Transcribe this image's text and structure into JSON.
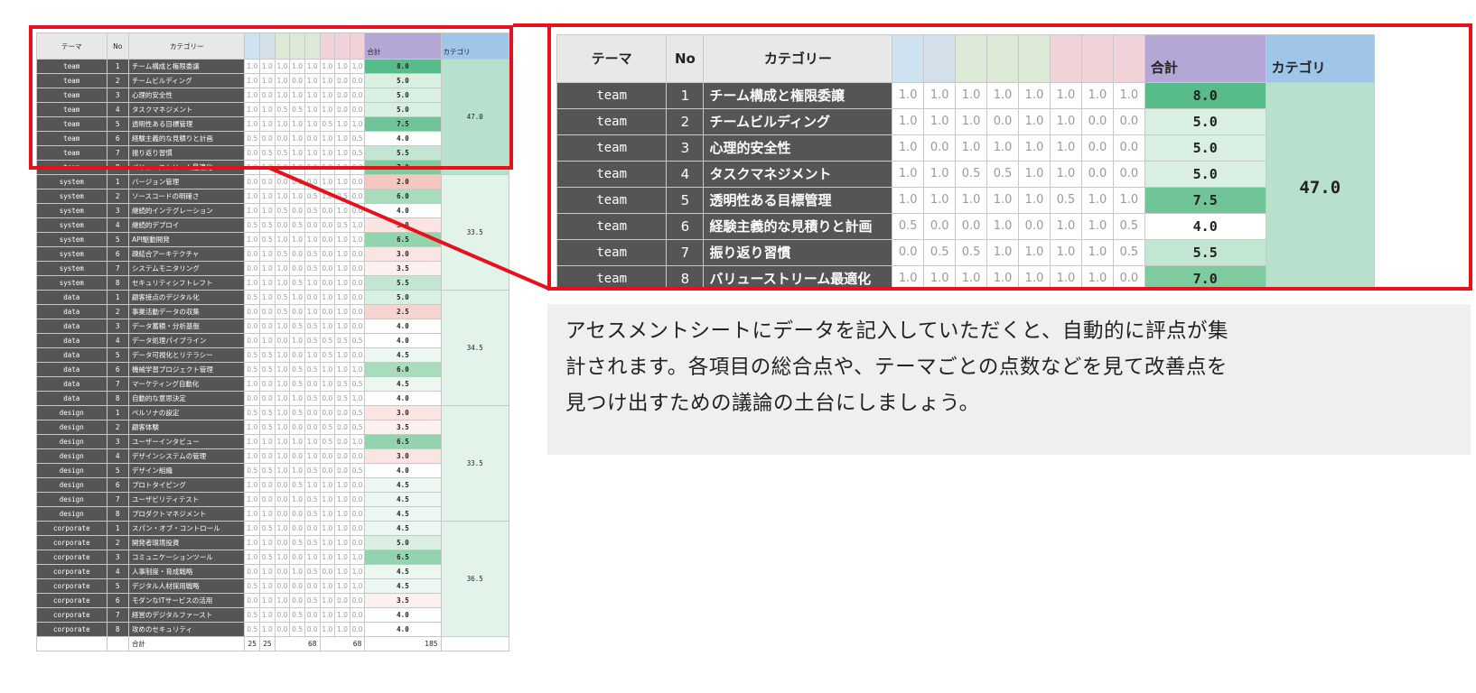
{
  "headers": {
    "theme": "テーマ",
    "no": "No",
    "category": "カテゴリー",
    "sum": "合計",
    "category_total": "カテゴリ"
  },
  "header_colors": [
    "#cfe2f0",
    "#d3e0ea",
    "#dbe9d6",
    "#dbe9d6",
    "#dbe9d6",
    "#f1d2d8",
    "#f1d2d8",
    "#f1d2d8"
  ],
  "colors": {
    "dark_cell": "#555555",
    "sum_header": "#b4a7d6",
    "cat_header": "#9fc5e8",
    "highlight_red": "#e8101a",
    "catsum_fill": "#b7e1cd",
    "catsum_fill_light": "#e2f3ea"
  },
  "groups": [
    {
      "theme": "team",
      "total": "47.0",
      "rows": [
        {
          "no": "1",
          "category": "チーム構成と権限委譲",
          "scores": [
            "1.0",
            "1.0",
            "1.0",
            "1.0",
            "1.0",
            "1.0",
            "1.0",
            "1.0"
          ],
          "sum": "8.0",
          "sum_color": "#57bb8a"
        },
        {
          "no": "2",
          "category": "チームビルディング",
          "scores": [
            "1.0",
            "1.0",
            "1.0",
            "0.0",
            "1.0",
            "1.0",
            "0.0",
            "0.0"
          ],
          "sum": "5.0",
          "sum_color": "#d9efe2"
        },
        {
          "no": "3",
          "category": "心理的安全性",
          "scores": [
            "1.0",
            "0.0",
            "1.0",
            "1.0",
            "1.0",
            "1.0",
            "0.0",
            "0.0"
          ],
          "sum": "5.0",
          "sum_color": "#d9efe2"
        },
        {
          "no": "4",
          "category": "タスクマネジメント",
          "scores": [
            "1.0",
            "1.0",
            "0.5",
            "0.5",
            "1.0",
            "1.0",
            "0.0",
            "0.0"
          ],
          "sum": "5.0",
          "sum_color": "#d9efe2"
        },
        {
          "no": "5",
          "category": "透明性ある目標管理",
          "scores": [
            "1.0",
            "1.0",
            "1.0",
            "1.0",
            "1.0",
            "0.5",
            "1.0",
            "1.0"
          ],
          "sum": "7.5",
          "sum_color": "#6fc597"
        },
        {
          "no": "6",
          "category": "経験主義的な見積りと計画",
          "scores": [
            "0.5",
            "0.0",
            "0.0",
            "1.0",
            "0.0",
            "1.0",
            "1.0",
            "0.5"
          ],
          "sum": "4.0",
          "sum_color": "#ffffff"
        },
        {
          "no": "7",
          "category": "振り返り習慣",
          "scores": [
            "0.0",
            "0.5",
            "0.5",
            "1.0",
            "1.0",
            "1.0",
            "1.0",
            "0.5"
          ],
          "sum": "5.5",
          "sum_color": "#c2e6d1"
        },
        {
          "no": "8",
          "category": "バリューストリーム最適化",
          "scores": [
            "1.0",
            "1.0",
            "1.0",
            "1.0",
            "1.0",
            "1.0",
            "1.0",
            "0.0"
          ],
          "sum": "7.0",
          "sum_color": "#7ecb9f"
        }
      ]
    },
    {
      "theme": "system",
      "total": "33.5",
      "rows": [
        {
          "no": "1",
          "category": "バージョン管理",
          "scores": [
            "0.0",
            "0.0",
            "0.0",
            "0.0",
            "0.0",
            "1.0",
            "1.0",
            "0.0"
          ],
          "sum": "2.0",
          "sum_color": "#f4c7c3"
        },
        {
          "no": "2",
          "category": "ソースコードの明確さ",
          "scores": [
            "1.0",
            "1.0",
            "1.0",
            "1.0",
            "0.5",
            "1.0",
            "0.5",
            "0.0"
          ],
          "sum": "6.0",
          "sum_color": "#a8dcbc"
        },
        {
          "no": "3",
          "category": "継続的インテグレーション",
          "scores": [
            "1.0",
            "1.0",
            "0.5",
            "0.0",
            "0.5",
            "0.0",
            "1.0",
            "0.0"
          ],
          "sum": "4.0",
          "sum_color": "#ffffff"
        },
        {
          "no": "4",
          "category": "継続的デプロイ",
          "scores": [
            "0.5",
            "0.5",
            "0.0",
            "0.5",
            "0.0",
            "0.0",
            "0.5",
            "1.0"
          ],
          "sum": "3.0",
          "sum_color": "#fbe5e3"
        },
        {
          "no": "5",
          "category": "API駆動開発",
          "scores": [
            "1.0",
            "0.5",
            "1.0",
            "1.0",
            "1.0",
            "0.0",
            "1.0",
            "1.0"
          ],
          "sum": "6.5",
          "sum_color": "#93d3ad"
        },
        {
          "no": "6",
          "category": "疎結合アーキテクチャ",
          "scores": [
            "0.0",
            "1.0",
            "0.5",
            "0.0",
            "0.5",
            "0.0",
            "1.0",
            "0.0"
          ],
          "sum": "3.0",
          "sum_color": "#fbe5e3"
        },
        {
          "no": "7",
          "category": "システムモニタリング",
          "scores": [
            "0.0",
            "1.0",
            "1.0",
            "0.0",
            "0.5",
            "0.0",
            "1.0",
            "0.0"
          ],
          "sum": "3.5",
          "sum_color": "#fdf1f0"
        },
        {
          "no": "8",
          "category": "セキュリティシフトレフト",
          "scores": [
            "1.0",
            "1.0",
            "1.0",
            "0.5",
            "1.0",
            "0.0",
            "1.0",
            "0.0"
          ],
          "sum": "5.5",
          "sum_color": "#c2e6d1"
        }
      ]
    },
    {
      "theme": "data",
      "total": "34.5",
      "rows": [
        {
          "no": "1",
          "category": "顧客接点のデジタル化",
          "scores": [
            "0.5",
            "1.0",
            "0.5",
            "1.0",
            "0.0",
            "1.0",
            "1.0",
            "0.0"
          ],
          "sum": "5.0",
          "sum_color": "#d9efe2"
        },
        {
          "no": "2",
          "category": "事業活動データの収集",
          "scores": [
            "0.0",
            "0.0",
            "0.5",
            "0.0",
            "1.0",
            "0.0",
            "1.0",
            "0.0"
          ],
          "sum": "2.5",
          "sum_color": "#f6d4d0"
        },
        {
          "no": "3",
          "category": "データ蓄積・分析基盤",
          "scores": [
            "0.0",
            "0.0",
            "1.0",
            "0.5",
            "0.5",
            "1.0",
            "1.0",
            "0.0"
          ],
          "sum": "4.0",
          "sum_color": "#ffffff"
        },
        {
          "no": "4",
          "category": "データ処理パイプライン",
          "scores": [
            "0.0",
            "1.0",
            "0.0",
            "1.0",
            "0.5",
            "0.5",
            "0.5",
            "0.5"
          ],
          "sum": "4.0",
          "sum_color": "#ffffff"
        },
        {
          "no": "5",
          "category": "データ可視化とリテラシー",
          "scores": [
            "0.5",
            "0.5",
            "1.0",
            "0.0",
            "1.0",
            "0.5",
            "1.0",
            "0.0"
          ],
          "sum": "4.5",
          "sum_color": "#ecf7f1"
        },
        {
          "no": "6",
          "category": "機械学習プロジェクト管理",
          "scores": [
            "0.5",
            "0.5",
            "1.0",
            "0.5",
            "0.5",
            "1.0",
            "1.0",
            "1.0"
          ],
          "sum": "6.0",
          "sum_color": "#a8dcbc"
        },
        {
          "no": "7",
          "category": "マーケティング自動化",
          "scores": [
            "1.0",
            "0.0",
            "1.0",
            "0.5",
            "0.0",
            "1.0",
            "0.5",
            "0.5"
          ],
          "sum": "4.5",
          "sum_color": "#ecf7f1"
        },
        {
          "no": "8",
          "category": "自動的な意思決定",
          "scores": [
            "0.0",
            "0.0",
            "1.0",
            "1.0",
            "0.5",
            "0.0",
            "0.5",
            "1.0"
          ],
          "sum": "4.0",
          "sum_color": "#ffffff"
        }
      ]
    },
    {
      "theme": "design",
      "total": "33.5",
      "rows": [
        {
          "no": "1",
          "category": "ペルソナの設定",
          "scores": [
            "0.5",
            "0.5",
            "1.0",
            "0.5",
            "0.0",
            "0.0",
            "0.0",
            "0.5"
          ],
          "sum": "3.0",
          "sum_color": "#fbe5e3"
        },
        {
          "no": "2",
          "category": "顧客体験",
          "scores": [
            "1.0",
            "0.5",
            "1.0",
            "0.0",
            "0.0",
            "0.5",
            "0.0",
            "0.5"
          ],
          "sum": "3.5",
          "sum_color": "#fdf1f0"
        },
        {
          "no": "3",
          "category": "ユーザーインタビュー",
          "scores": [
            "1.0",
            "1.0",
            "1.0",
            "1.0",
            "1.0",
            "0.5",
            "0.0",
            "1.0"
          ],
          "sum": "6.5",
          "sum_color": "#93d3ad"
        },
        {
          "no": "4",
          "category": "デザインシステムの管理",
          "scores": [
            "1.0",
            "0.0",
            "1.0",
            "0.0",
            "1.0",
            "0.0",
            "0.0",
            "0.0"
          ],
          "sum": "3.0",
          "sum_color": "#fbe5e3"
        },
        {
          "no": "5",
          "category": "デザイン組織",
          "scores": [
            "0.5",
            "0.5",
            "1.0",
            "1.0",
            "0.5",
            "0.0",
            "0.0",
            "0.5"
          ],
          "sum": "4.0",
          "sum_color": "#ffffff"
        },
        {
          "no": "6",
          "category": "プロトタイピング",
          "scores": [
            "1.0",
            "0.0",
            "0.0",
            "0.5",
            "1.0",
            "1.0",
            "1.0",
            "0.0"
          ],
          "sum": "4.5",
          "sum_color": "#ecf7f1"
        },
        {
          "no": "7",
          "category": "ユーザビリティテスト",
          "scores": [
            "1.0",
            "0.0",
            "0.0",
            "1.0",
            "0.5",
            "1.0",
            "1.0",
            "0.0"
          ],
          "sum": "4.5",
          "sum_color": "#ecf7f1"
        },
        {
          "no": "8",
          "category": "プロダクトマネジメント",
          "scores": [
            "1.0",
            "1.0",
            "0.0",
            "0.0",
            "0.5",
            "1.0",
            "1.0",
            "0.0"
          ],
          "sum": "4.5",
          "sum_color": "#ecf7f1"
        }
      ]
    },
    {
      "theme": "corporate",
      "total": "36.5",
      "rows": [
        {
          "no": "1",
          "category": "スパン・オブ・コントロール",
          "scores": [
            "1.0",
            "0.5",
            "1.0",
            "0.0",
            "0.0",
            "1.0",
            "1.0",
            "0.0"
          ],
          "sum": "4.5",
          "sum_color": "#ecf7f1"
        },
        {
          "no": "2",
          "category": "開発者環境投資",
          "scores": [
            "1.0",
            "1.0",
            "0.0",
            "0.5",
            "0.5",
            "1.0",
            "1.0",
            "0.0"
          ],
          "sum": "5.0",
          "sum_color": "#d9efe2"
        },
        {
          "no": "3",
          "category": "コミュニケーションツール",
          "scores": [
            "1.0",
            "0.5",
            "1.0",
            "0.0",
            "1.0",
            "1.0",
            "1.0",
            "1.0"
          ],
          "sum": "6.5",
          "sum_color": "#93d3ad"
        },
        {
          "no": "4",
          "category": "人事制度・育成戦略",
          "scores": [
            "0.0",
            "1.0",
            "0.0",
            "1.0",
            "0.5",
            "0.0",
            "1.0",
            "1.0"
          ],
          "sum": "4.5",
          "sum_color": "#ecf7f1"
        },
        {
          "no": "5",
          "category": "デジタル人材採用戦略",
          "scores": [
            "0.5",
            "1.0",
            "0.0",
            "0.0",
            "0.0",
            "1.0",
            "1.0",
            "1.0"
          ],
          "sum": "4.5",
          "sum_color": "#ecf7f1"
        },
        {
          "no": "6",
          "category": "モダンなITサービスの活用",
          "scores": [
            "0.0",
            "1.0",
            "1.0",
            "0.0",
            "0.5",
            "1.0",
            "0.0",
            "0.0"
          ],
          "sum": "3.5",
          "sum_color": "#fdf1f0"
        },
        {
          "no": "7",
          "category": "経営のデジタルファースト",
          "scores": [
            "0.5",
            "1.0",
            "0.0",
            "0.5",
            "0.0",
            "1.0",
            "1.0",
            "0.0"
          ],
          "sum": "4.0",
          "sum_color": "#ffffff"
        },
        {
          "no": "8",
          "category": "攻めのセキュリティ",
          "scores": [
            "0.5",
            "1.0",
            "0.0",
            "0.5",
            "0.0",
            "1.0",
            "1.0",
            "0.0"
          ],
          "sum": "4.0",
          "sum_color": "#ffffff"
        }
      ]
    }
  ],
  "footer": {
    "label": "合計",
    "col1": "25",
    "col2": "25",
    "col3": "68",
    "col4": "68",
    "grand": "185"
  },
  "caption": {
    "line1": "アセスメントシートにデータを記入していただくと、自動的に評点が集",
    "line2": "計されます。各項目の総合点や、テーマごとの点数などを見て改善点を",
    "line3": "見つけ出すための議論の土台にしましょう。"
  }
}
